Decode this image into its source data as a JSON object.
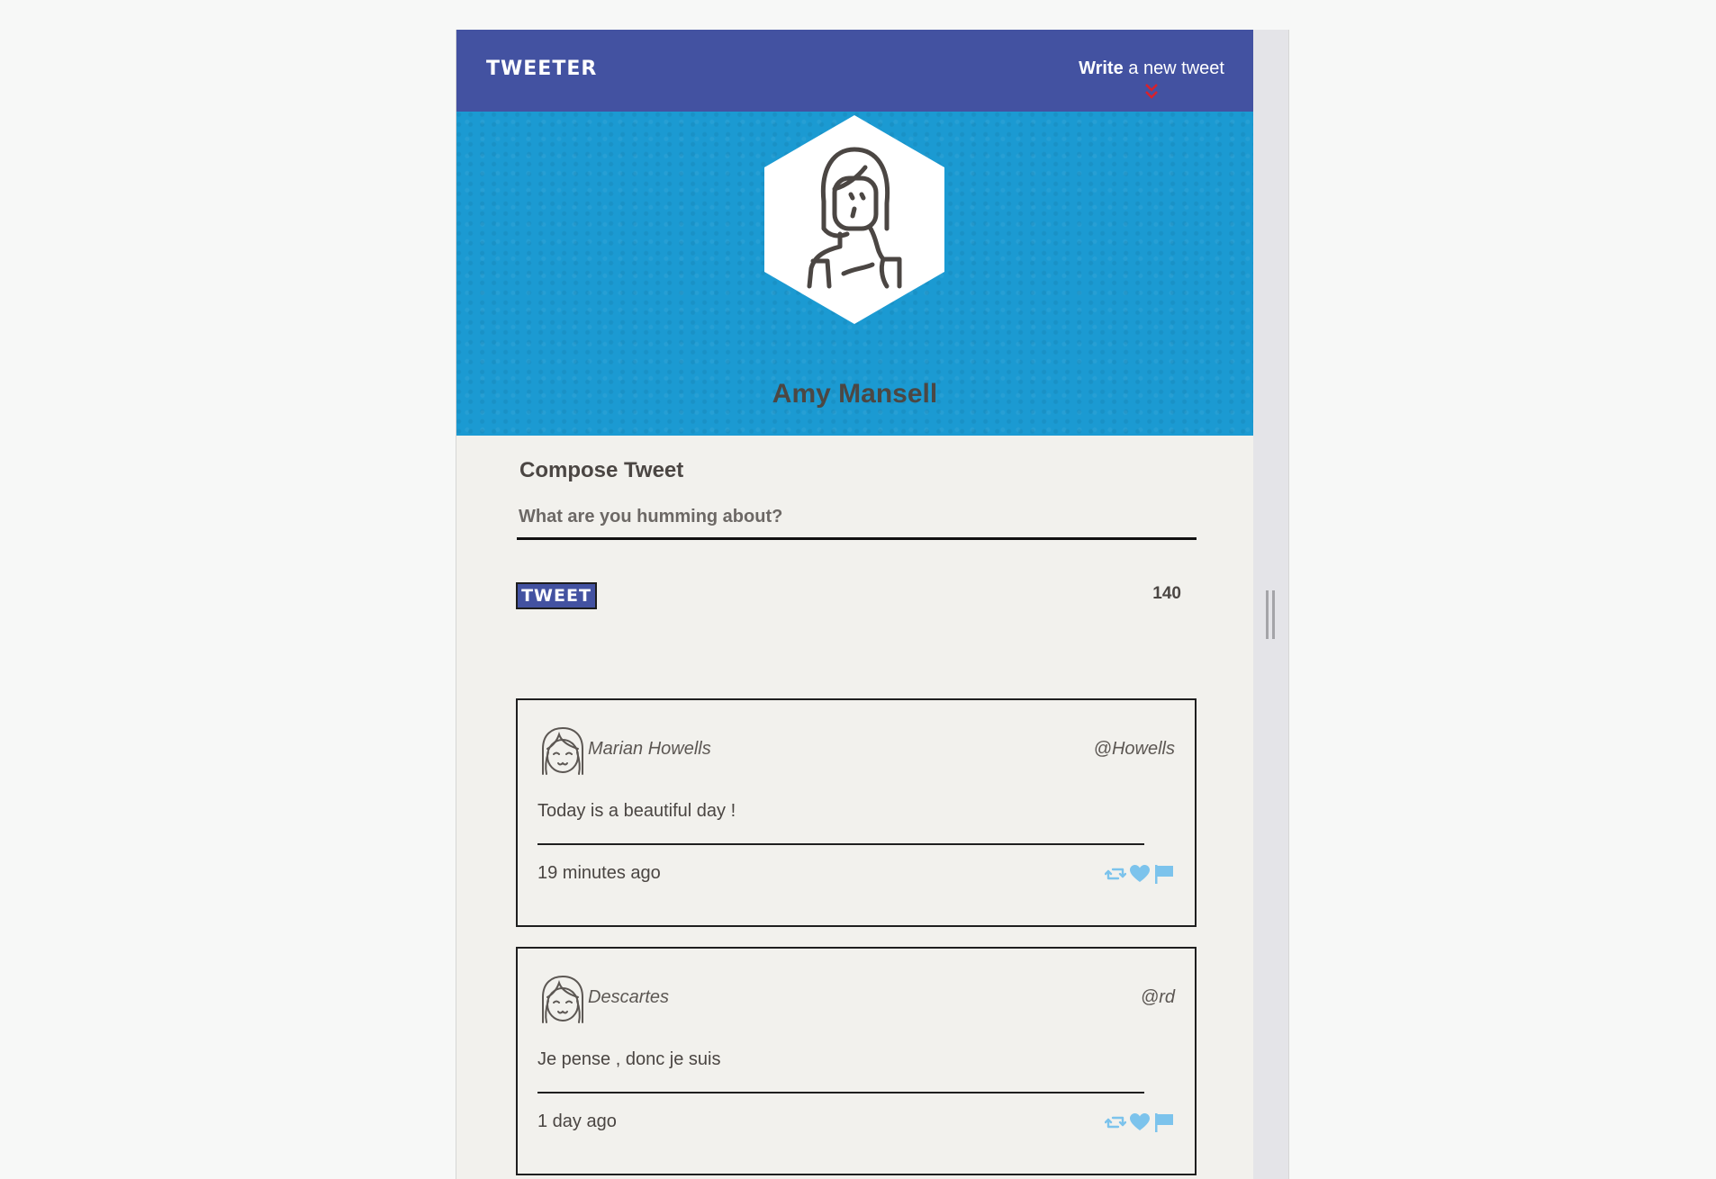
{
  "nav": {
    "brand": "TWEETER",
    "compose_toggle_strong": "Write",
    "compose_toggle_rest": " a new tweet",
    "chevron_icon": "double-chevron-down-icon",
    "chevron_color": "#d9212c"
  },
  "colors": {
    "nav_bg": "#4352a1",
    "header_bg": "#1b9ad2",
    "page_bg": "#f2f1ed",
    "action_icon": "#7cc3ec"
  },
  "profile": {
    "name": "Amy Mansell",
    "avatar_icon": "woman-avatar-icon"
  },
  "compose": {
    "title": "Compose Tweet",
    "placeholder": "What are you humming about?",
    "value": "",
    "button_label": "TWEET",
    "char_count": "140"
  },
  "tweets": [
    {
      "author": "Marian Howells",
      "handle": "@Howells",
      "text": "Today is a beautiful day !",
      "time": "19 minutes ago",
      "avatar_icon": "girl-avatar-icon"
    },
    {
      "author": "Descartes",
      "handle": "@rd",
      "text": "Je pense , donc je suis",
      "time": "1 day ago",
      "avatar_icon": "girl-avatar-icon"
    }
  ],
  "actions": [
    "retweet-icon",
    "heart-icon",
    "flag-icon"
  ]
}
